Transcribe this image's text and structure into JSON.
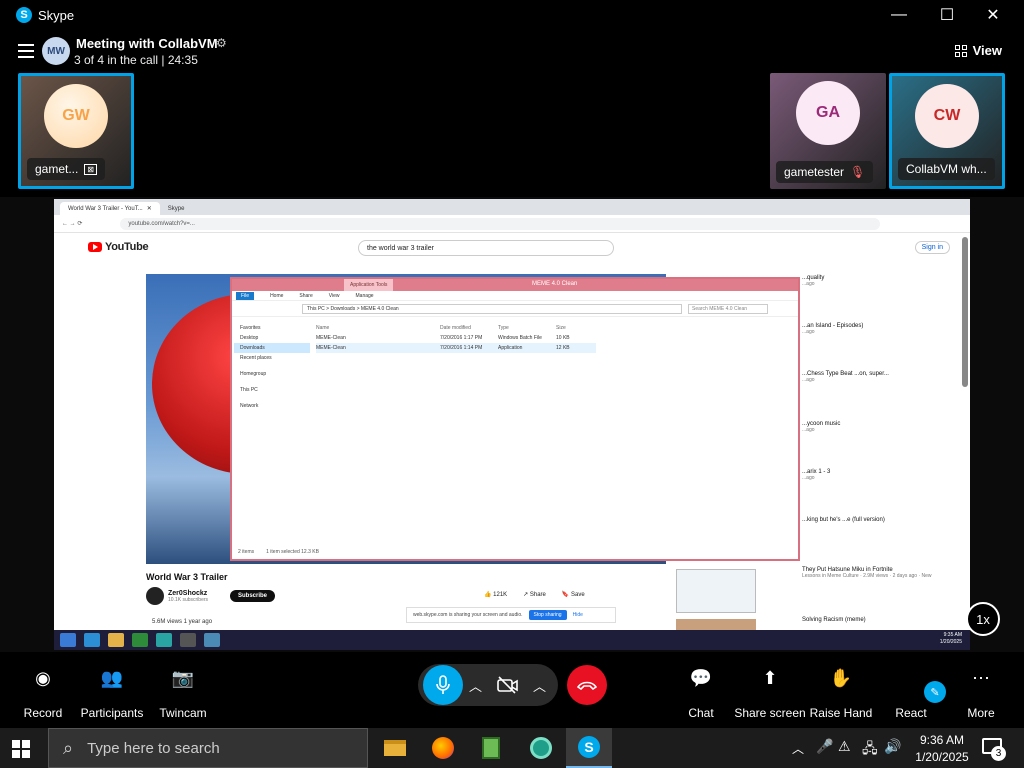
{
  "window": {
    "app_title": "Skype",
    "minimize": "—",
    "maximize": "☐",
    "close": "✕"
  },
  "call": {
    "avatar_initials": "MW",
    "meeting_name": "Meeting with CollabVM",
    "status": "3 of 4 in the call | 24:35",
    "view_label": "View"
  },
  "participants": [
    {
      "initials": "GW",
      "name": "gamet...",
      "color": "#f6a34a",
      "bg": "#6b5548",
      "active": true
    },
    {
      "initials": "GA",
      "name": "gametester",
      "color": "#9b2a79",
      "bg": "#7a5a78",
      "active": false
    },
    {
      "initials": "CW",
      "name": "CollabVM wh...",
      "color": "#c92828",
      "bg": "#2a6f88",
      "active": true
    }
  ],
  "shared_screen": {
    "browser": {
      "tab1": "World War 3 Trailer - YouT...",
      "tab2": "Skype",
      "url": "youtube.com/watch?v=..."
    },
    "youtube": {
      "logo_text": "YouTube",
      "search_query": "the world war 3 trailer",
      "sign_in": "Sign in",
      "video_title": "World War 3 Trailer",
      "channel": "Zer0Shockz",
      "subscribers": "10.1K subscribers",
      "subscribe": "Subscribe",
      "likes": "121K",
      "share": "Share",
      "save": "Save",
      "views": "5.6M views  1 year ago",
      "share_notice": "web.skype.com is sharing your screen and audio.",
      "stop_sharing": "Stop sharing",
      "hide": "Hide",
      "sidebar": [
        {
          "title": "...quality",
          "meta": "...ago"
        },
        {
          "title": "...an Island - Episodes)",
          "meta": "...ago"
        },
        {
          "title": "...Chess Type Beat ...on, super...",
          "meta": "...ago"
        },
        {
          "title": "...ycoon music",
          "meta": "...ago"
        },
        {
          "title": "...arix 1 - 3",
          "meta": "...ago"
        },
        {
          "title": "...king but he's ...e (full version)",
          "meta": ""
        },
        {
          "title": "They Put Hatsune Miku in Fortnite",
          "meta": "Lessons in Meme Culture · 2.9M views · 2 days ago · New"
        },
        {
          "title": "Solving Racism (meme)",
          "meta": ""
        }
      ]
    },
    "explorer": {
      "title": "MEME 4.0 Clean",
      "app_tools": "Application Tools",
      "ribbon": [
        "File",
        "Home",
        "Share",
        "View",
        "Manage"
      ],
      "path": "This PC  >  Downloads  >  MEME 4.0 Clean",
      "search": "Search MEME 4.0 Clean",
      "nav": [
        "Favorites",
        "Desktop",
        "Downloads",
        "Recent places",
        "Homegroup",
        "This PC",
        "Network"
      ],
      "columns": [
        "Name",
        "Date modified",
        "Type",
        "Size"
      ],
      "files": [
        {
          "name": "MEME-Clean",
          "date": "7/20/2016 1:17 PM",
          "type": "Windows Batch File",
          "size": "10 KB"
        },
        {
          "name": "MEME-Clean",
          "date": "7/20/2016 1:14 PM",
          "type": "Application",
          "size": "12 KB"
        }
      ],
      "status_items": "2 items",
      "status_selected": "1 item selected  12.3 KB"
    },
    "inner_clock": {
      "time": "9:35 AM",
      "date": "1/20/2025"
    }
  },
  "playback_speed": "1x",
  "controls": {
    "record": "Record",
    "participants": "Participants",
    "twincam": "Twincam",
    "chat": "Chat",
    "share_screen": "Share screen",
    "raise_hand": "Raise Hand",
    "react": "React",
    "more": "More"
  },
  "taskbar": {
    "search_placeholder": "Type here to search",
    "time": "9:36 AM",
    "date": "1/20/2025",
    "notification_count": "3"
  }
}
